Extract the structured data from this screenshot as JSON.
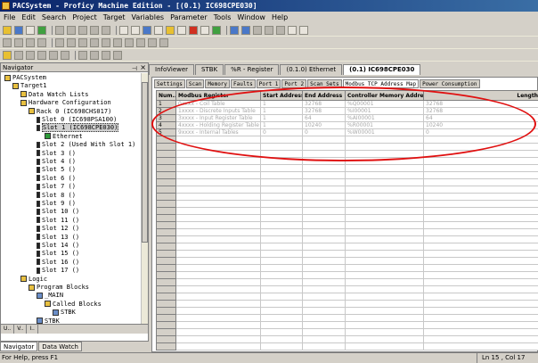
{
  "window": {
    "title": "PACSystem - Proficy Machine Edition - [(0.1) IC698CPE030]"
  },
  "menu": [
    "File",
    "Edit",
    "Search",
    "Project",
    "Target",
    "Variables",
    "Parameter",
    "Tools",
    "Window",
    "Help"
  ],
  "navigator": {
    "title": "Navigator",
    "tree": [
      {
        "label": "PACSystem",
        "depth": 0,
        "icon": "project-icon"
      },
      {
        "label": "Target1",
        "depth": 1,
        "icon": "target-icon"
      },
      {
        "label": "Data Watch Lists",
        "depth": 2,
        "icon": "folder-icon"
      },
      {
        "label": "Hardware Configuration",
        "depth": 2,
        "icon": "folder-icon"
      },
      {
        "label": "Rack 0 (IC698CHS017)",
        "depth": 3,
        "icon": "rack-icon"
      },
      {
        "label": "Slot 0 (IC698PSA100)",
        "depth": 4,
        "icon": "slot-icon"
      },
      {
        "label": "Slot 1 (IC698CPE030)",
        "depth": 4,
        "icon": "slot-icon",
        "selected": true
      },
      {
        "label": "Ethernet",
        "depth": 5,
        "icon": "ethernet-icon"
      },
      {
        "label": "Slot 2 (Used With Slot 1)",
        "depth": 4,
        "icon": "slot-icon"
      },
      {
        "label": "Slot 3 ()",
        "depth": 4,
        "icon": "slot-icon"
      },
      {
        "label": "Slot 4 ()",
        "depth": 4,
        "icon": "slot-icon"
      },
      {
        "label": "Slot 5 ()",
        "depth": 4,
        "icon": "slot-icon"
      },
      {
        "label": "Slot 6 ()",
        "depth": 4,
        "icon": "slot-icon"
      },
      {
        "label": "Slot 7 ()",
        "depth": 4,
        "icon": "slot-icon"
      },
      {
        "label": "Slot 8 ()",
        "depth": 4,
        "icon": "slot-icon"
      },
      {
        "label": "Slot 9 ()",
        "depth": 4,
        "icon": "slot-icon"
      },
      {
        "label": "Slot 10 ()",
        "depth": 4,
        "icon": "slot-icon"
      },
      {
        "label": "Slot 11 ()",
        "depth": 4,
        "icon": "slot-icon"
      },
      {
        "label": "Slot 12 ()",
        "depth": 4,
        "icon": "slot-icon"
      },
      {
        "label": "Slot 13 ()",
        "depth": 4,
        "icon": "slot-icon"
      },
      {
        "label": "Slot 14 ()",
        "depth": 4,
        "icon": "slot-icon"
      },
      {
        "label": "Slot 15 ()",
        "depth": 4,
        "icon": "slot-icon"
      },
      {
        "label": "Slot 16 ()",
        "depth": 4,
        "icon": "slot-icon"
      },
      {
        "label": "Slot 17 ()",
        "depth": 4,
        "icon": "slot-icon"
      },
      {
        "label": "Logic",
        "depth": 2,
        "icon": "logic-icon"
      },
      {
        "label": "Program Blocks",
        "depth": 3,
        "icon": "folder-icon"
      },
      {
        "label": "_MAIN",
        "depth": 4,
        "icon": "block-icon"
      },
      {
        "label": "Called Blocks",
        "depth": 5,
        "icon": "folder-icon"
      },
      {
        "label": "STBK",
        "depth": 6,
        "icon": "block-icon"
      },
      {
        "label": "STBK",
        "depth": 4,
        "icon": "block-icon"
      }
    ],
    "tabs": [
      "U..",
      "V..",
      "I.."
    ]
  },
  "bottom_tabs": [
    "Navigator",
    "Data Watch"
  ],
  "doc_tabs": [
    "InfoViewer",
    "STBK",
    "%R - Register",
    "(0.1.0) Ethernet",
    "(0.1) IC698CPE030"
  ],
  "sub_tabs": [
    "Settings",
    "Scan",
    "Memory",
    "Faults",
    "Port 1",
    "Port 2",
    "Scan Sets",
    "Modbus TCP Address Map",
    "Power Consumption"
  ],
  "table": {
    "headers": [
      "Num...",
      "Modbus Register",
      "Start Address",
      "End Address",
      "Controller Memory Address",
      "Length"
    ],
    "rows": [
      [
        "1",
        "0xxxx - Coil Table",
        "1",
        "32768",
        "%Q00001",
        "32768"
      ],
      [
        "2",
        "1xxxx - Discrete Inputs Table",
        "1",
        "32768",
        "%I00001",
        "32768"
      ],
      [
        "3",
        "3xxxx - Input Register Table",
        "1",
        "64",
        "%AI00001",
        "64"
      ],
      [
        "4",
        "4xxxx - Holding Register Table",
        "1",
        "10240",
        "%R00001",
        "10240"
      ],
      [
        "5",
        "9xxxx - Internal Tables",
        "0",
        "0",
        "%W00001",
        "0"
      ]
    ],
    "empty_rows": 30
  },
  "status": {
    "help": "For Help, press F1",
    "position": "Ln 15 , Col 17"
  },
  "annotation_color": "#e01010"
}
